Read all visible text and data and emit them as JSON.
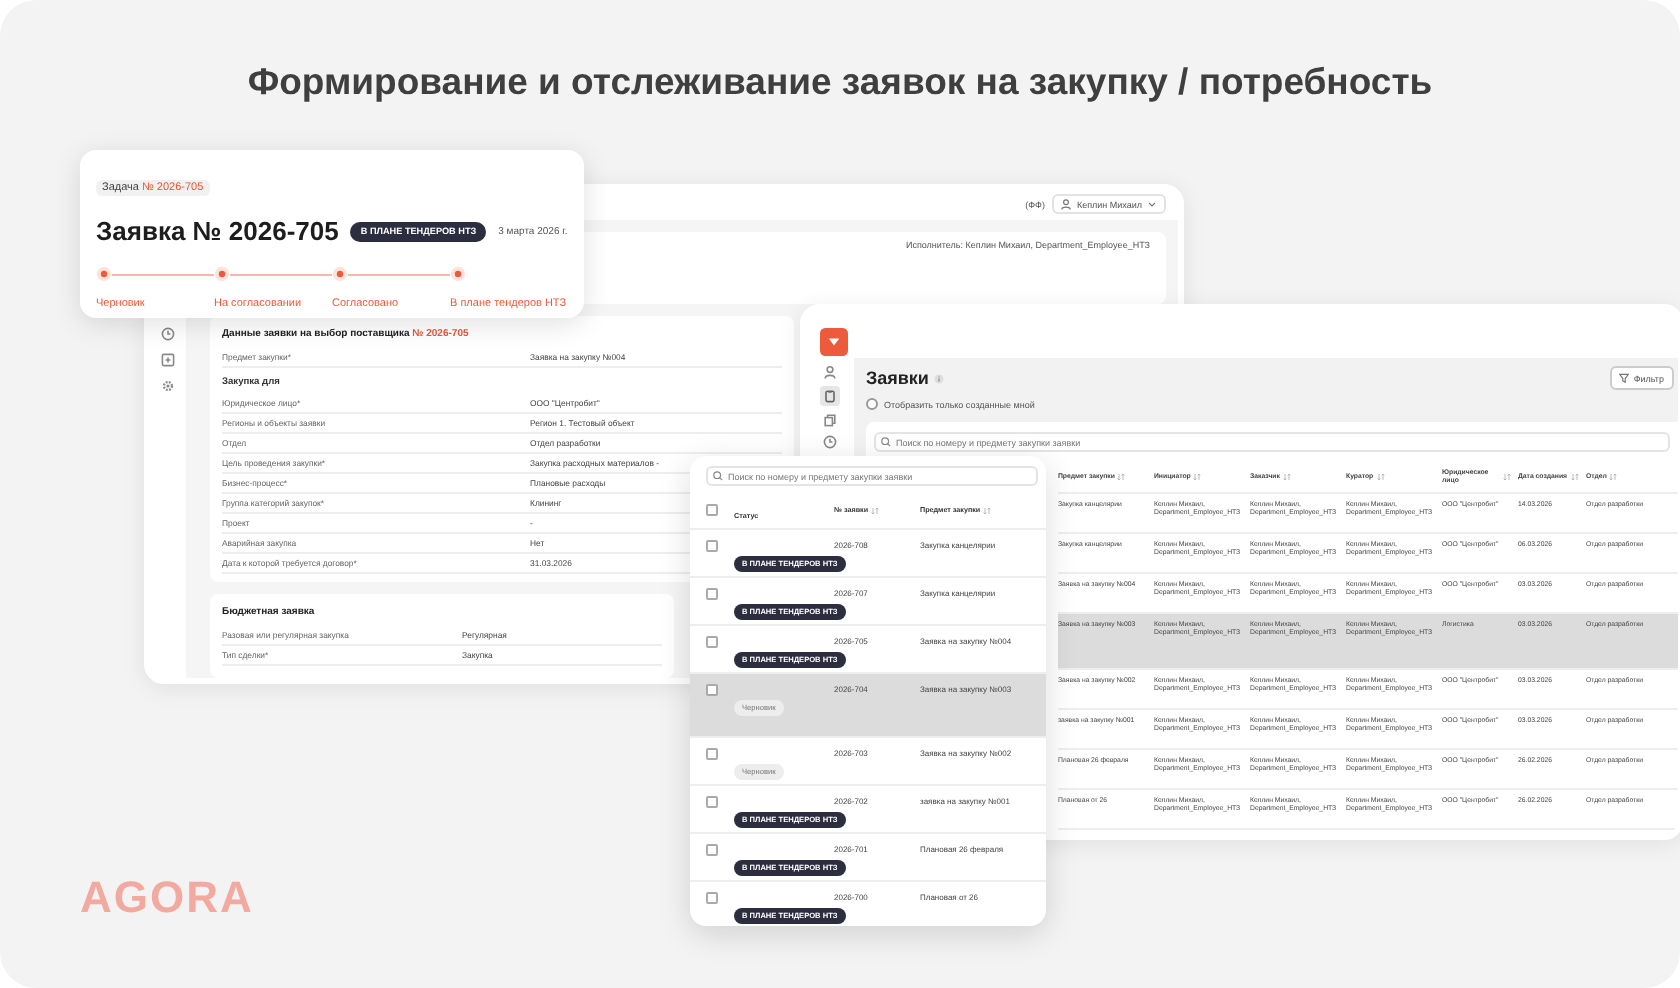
{
  "headline": "Формирование и отслеживание заявок на закупку / потребность",
  "status_card": {
    "task_label": "Задача",
    "task_number": "№ 2026-705",
    "title": "Заявка № 2026-705",
    "status": "В ПЛАНЕ ТЕНДЕРОВ НТЗ",
    "date": "3 марта 2026 г.",
    "steps": [
      {
        "label": "Черновик"
      },
      {
        "label": "На согласовании"
      },
      {
        "label": "Согласовано"
      },
      {
        "label": "В плане тендеров НТЗ"
      }
    ]
  },
  "detail_window": {
    "header": {
      "counter": "(ФФ)",
      "user": "Кеплин Михаил"
    },
    "executor": "Исполнитель: Кеплин Михаил, Department_Employee_НТЗ",
    "form": {
      "title": "Данные заявки на выбор поставщика",
      "number": "№ 2026-705",
      "rows": [
        {
          "kind": "field",
          "label": "Предмет закупки*",
          "value": "Заявка на закупку №004"
        },
        {
          "kind": "section",
          "label": "Закупка для"
        },
        {
          "kind": "field",
          "label": "Юридическое лицо*",
          "value": "ООО \"Центробит\""
        },
        {
          "kind": "field",
          "label": "Регионы и объекты заявки",
          "value": "Регион 1. Тестовый объект"
        },
        {
          "kind": "field",
          "label": "Отдел",
          "value": "Отдел разработки"
        },
        {
          "kind": "field",
          "label": "Цель проведения закупки*",
          "value": "Закупка расходных материалов -"
        },
        {
          "kind": "field",
          "label": "Бизнес-процесс*",
          "value": "Плановые расходы"
        },
        {
          "kind": "field",
          "label": "Группа категорий закупок*",
          "value": "Клининг"
        },
        {
          "kind": "field",
          "label": "Проект",
          "value": "-"
        },
        {
          "kind": "field",
          "label": "Аварийная закупка",
          "value": "Нет"
        },
        {
          "kind": "field",
          "label": "Дата к которой требуется договор*",
          "value": "31.03.2026"
        }
      ]
    },
    "budget": {
      "title": "Бюджетная заявка",
      "rows": [
        {
          "label": "Разовая или регулярная закупка",
          "value": "Регулярная"
        },
        {
          "label": "Тип сделки*",
          "value": "Закупка"
        }
      ]
    }
  },
  "requests_window": {
    "title": "Заявки",
    "filter_checkbox": {
      "label": "Отобразить только созданные мной",
      "checked": false
    },
    "filter_button": "Фильтр",
    "search_placeholder": "Поиск по номеру и предмету закупки заявки",
    "columns": [
      "Предмет закупки",
      "Инициатор",
      "Заказчик",
      "Куратор",
      "Юридическое лицо",
      "Дата создания",
      "Отдел"
    ],
    "rows": [
      {
        "selected": false,
        "cells": [
          "Закупка канцелярии",
          "Кеплин Михаил, Department_Employee_НТЗ",
          "Кеплин Михаил, Department_Employee_НТЗ",
          "Кеплин Михаил, Department_Employee_НТЗ",
          "ООО \"Центробит\"",
          "14.03.2026",
          "Отдел разработки"
        ]
      },
      {
        "selected": false,
        "cells": [
          "Закупка канцелярии",
          "Кеплин Михаил, Department_Employee_НТЗ",
          "Кеплин Михаил, Department_Employee_НТЗ",
          "Кеплин Михаил, Department_Employee_НТЗ",
          "ООО \"Центробит\"",
          "06.03.2026",
          "Отдел разработки"
        ]
      },
      {
        "selected": false,
        "cells": [
          "Заявка на закупку №004",
          "Кеплин Михаил, Department_Employee_НТЗ",
          "Кеплин Михаил, Department_Employee_НТЗ",
          "Кеплин Михаил, Department_Employee_НТЗ",
          "ООО \"Центробит\"",
          "03.03.2026",
          "Отдел разработки"
        ]
      },
      {
        "selected": true,
        "cells": [
          "Заявка на закупку №003",
          "Кеплин Михаил, Department_Employee_НТЗ",
          "Кеплин Михаил, Department_Employee_НТЗ",
          "Кеплин Михаил, Department_Employee_НТЗ",
          "Логистика",
          "03.03.2026",
          "Отдел разработки"
        ]
      },
      {
        "selected": false,
        "cells": [
          "Заявка на закупку №002",
          "Кеплин Михаил, Department_Employee_НТЗ",
          "Кеплин Михаил, Department_Employee_НТЗ",
          "Кеплин Михаил, Department_Employee_НТЗ",
          "ООО \"Центробит\"",
          "03.03.2026",
          "Отдел разработки"
        ]
      },
      {
        "selected": false,
        "cells": [
          "заявка на закупку №001",
          "Кеплин Михаил, Department_Employee_НТЗ",
          "Кеплин Михаил, Department_Employee_НТЗ",
          "Кеплин Михаил, Department_Employee_НТЗ",
          "ООО \"Центробит\"",
          "03.03.2026",
          "Отдел разработки"
        ]
      },
      {
        "selected": false,
        "cells": [
          "Плановая 26 февраля",
          "Кеплин Михаил, Department_Employee_НТЗ",
          "Кеплин Михаил, Department_Employee_НТЗ",
          "Кеплин Михаил, Department_Employee_НТЗ",
          "ООО \"Центробит\"",
          "26.02.2026",
          "Отдел разработки"
        ]
      },
      {
        "selected": false,
        "cells": [
          "Плановая от 26",
          "Кеплин Михаил, Department_Employee_НТЗ",
          "Кеплин Михаил, Department_Employee_НТЗ",
          "Кеплин Михаил, Department_Employee_НТЗ",
          "ООО \"Центробит\"",
          "26.02.2026",
          "Отдел разработки"
        ]
      }
    ]
  },
  "list_card": {
    "select_all_checked": false,
    "search_placeholder": "Поиск по номеру и предмету закупки заявки",
    "columns": [
      "Статус",
      "№ заявки",
      "Предмет закупки"
    ],
    "rows": [
      {
        "checked": false,
        "selected": false,
        "status": {
          "kind": "plan",
          "label": "В ПЛАНЕ ТЕНДЕРОВ НТЗ"
        },
        "number": "2026-708",
        "subject": "Закупка канцелярии"
      },
      {
        "checked": false,
        "selected": false,
        "status": {
          "kind": "plan",
          "label": "В ПЛАНЕ ТЕНДЕРОВ НТЗ"
        },
        "number": "2026-707",
        "subject": "Закупка канцелярии"
      },
      {
        "checked": false,
        "selected": false,
        "status": {
          "kind": "plan",
          "label": "В ПЛАНЕ ТЕНДЕРОВ НТЗ"
        },
        "number": "2026-705",
        "subject": "Заявка на закупку №004"
      },
      {
        "checked": false,
        "selected": true,
        "status": {
          "kind": "draft",
          "label": "Черновик"
        },
        "number": "2026-704",
        "subject": "Заявка на закупку №003"
      },
      {
        "checked": false,
        "selected": false,
        "status": {
          "kind": "draft",
          "label": "Черновик"
        },
        "number": "2026-703",
        "subject": "Заявка на закупку №002"
      },
      {
        "checked": false,
        "selected": false,
        "status": {
          "kind": "plan",
          "label": "В ПЛАНЕ ТЕНДЕРОВ НТЗ"
        },
        "number": "2026-702",
        "subject": "заявка на закупку №001"
      },
      {
        "checked": false,
        "selected": false,
        "status": {
          "kind": "plan",
          "label": "В ПЛАНЕ ТЕНДЕРОВ НТЗ"
        },
        "number": "2026-701",
        "subject": "Плановая 26 февраля"
      },
      {
        "checked": false,
        "selected": false,
        "status": {
          "kind": "plan",
          "label": "В ПЛАНЕ ТЕНДЕРОВ НТЗ"
        },
        "number": "2026-700",
        "subject": "Плановая от 26"
      }
    ]
  },
  "logo": "AGORA"
}
